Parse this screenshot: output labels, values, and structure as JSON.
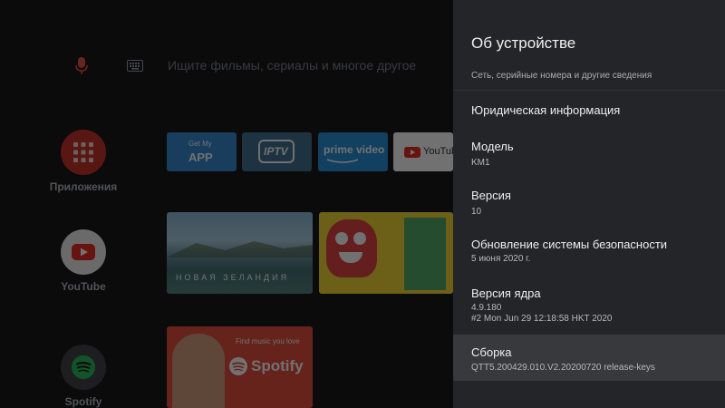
{
  "colors": {
    "panel_bg": "#242528",
    "panel_selected": "#38393c",
    "apps_red": "#c62a22",
    "youtube_red": "#e62117",
    "spotify_green": "#1db954",
    "prime_blue": "#1b8ad8"
  },
  "search": {
    "mic_icon": "microphone-icon",
    "keyboard_icon": "keyboard-icon",
    "hint": "Ищите фильмы, сериалы и многое другое"
  },
  "apps": [
    {
      "label": "Приложения",
      "icon": "grid-icon"
    },
    {
      "label": "YouTube",
      "icon": "play-icon"
    },
    {
      "label": "Spotify",
      "icon": "spotify-icon"
    }
  ],
  "row1": {
    "getmyapp_small": "Get My",
    "getmyapp_big": "APP",
    "iptv": "IPTV",
    "prime": "prime video",
    "youtube": "YouTube"
  },
  "row2": {
    "nz_caption": "НОВАЯ ЗЕЛАНДИЯ"
  },
  "row3": {
    "find_music": "Find music you love",
    "spotify": "Spotify"
  },
  "panel": {
    "title": "Об устройстве",
    "description": "Сеть, серийные номера и другие сведения",
    "items": [
      {
        "title": "Юридическая информация",
        "value": ""
      },
      {
        "title": "Модель",
        "value": "KM1"
      },
      {
        "title": "Версия",
        "value": "10"
      },
      {
        "title": "Обновление системы безопасности",
        "value": "5 июня 2020 г."
      },
      {
        "title": "Версия ядра",
        "value": "4.9.180",
        "value2": "#2 Mon Jun 29 12:18:58 HKT 2020"
      },
      {
        "title": "Сборка",
        "value": "QTT5.200429.010.V2.20200720 release-keys",
        "selected": true
      }
    ]
  }
}
